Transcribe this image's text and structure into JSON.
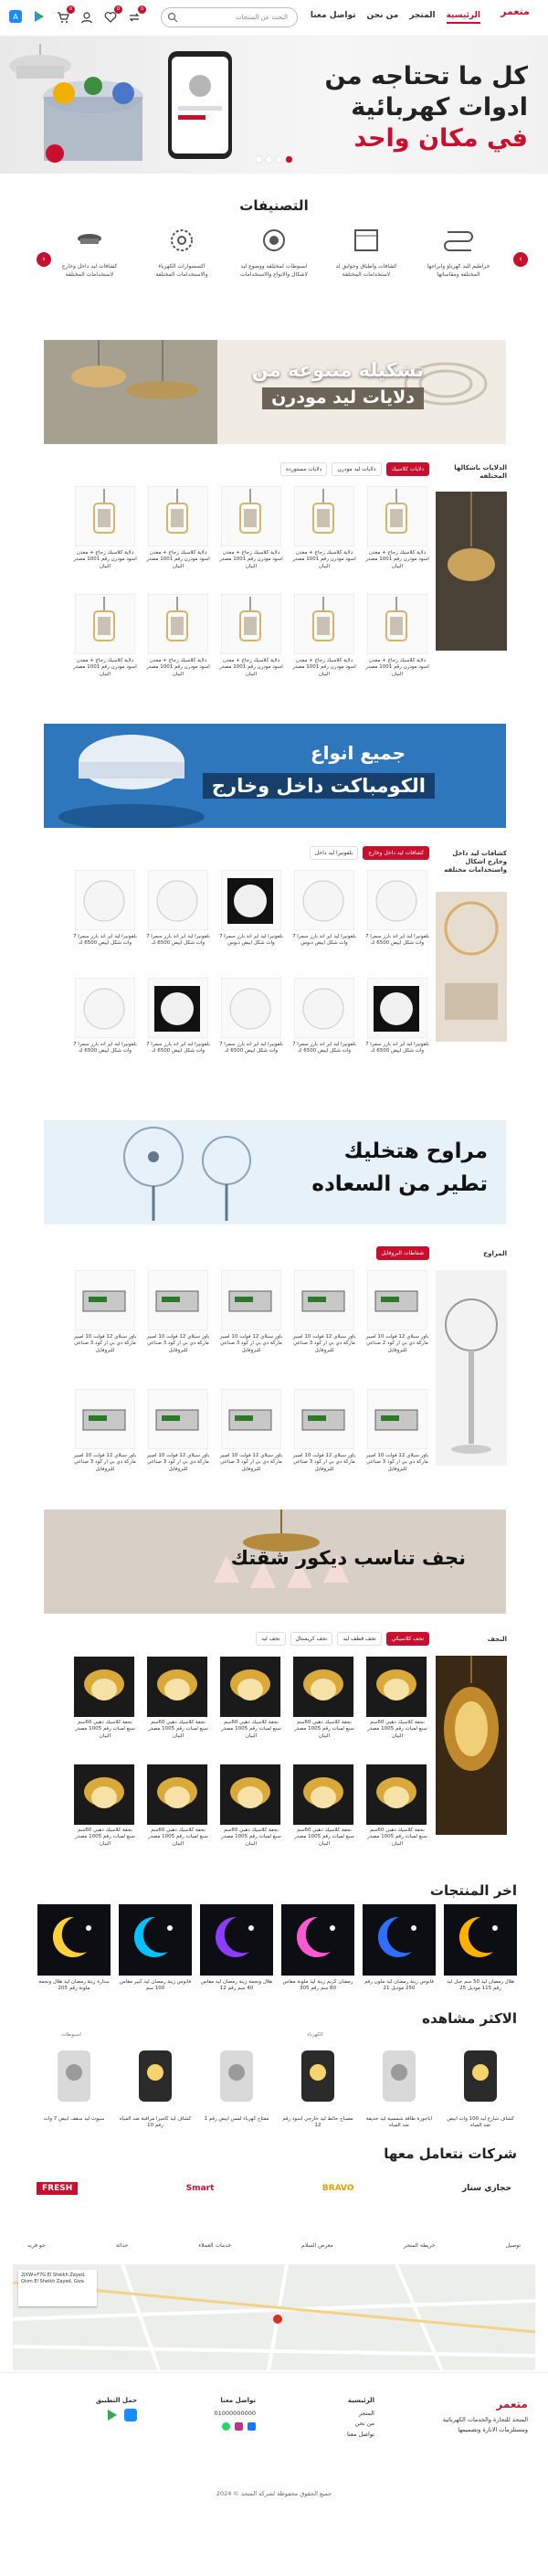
{
  "header": {
    "logo": "متعمر",
    "nav": [
      "الرئيسية",
      "المتجر",
      "من نحن",
      "تواصل معنا"
    ],
    "search_placeholder": "البحث عن المنتجات",
    "cart_count": "0",
    "wish_count": "0",
    "compare_count": "0"
  },
  "hero": {
    "line1": "كل ما تحتاجه من",
    "line2": "ادوات كهربائية",
    "line3": "في مكان واحد",
    "slides": 4,
    "active": 1
  },
  "categories": {
    "title": "التصنيفات",
    "items": [
      "خراطيم لليد كهرباؤ وابراجها المختلفه ومقاساتها",
      "كشافات واطباق وحوايق لد لاستخدامات المختلفة",
      "اسبوطات لمختلفه ووضوع ليد لاشكال والانواع والاستخدامات",
      "اكسسوارات الكهرباء والاستخدامات المختلفة",
      "كشافات ليد داخل وخارج لاستخدامات المختلفة",
      "كشافات ليد داخل وخارج لاستخدامات مختلفة"
    ]
  },
  "banner1": {
    "l1": "تشكيلة متنوعة من",
    "l2": "دلايات ليد مودرن"
  },
  "sec1": {
    "side": "الدلايات باشكالها المختلفه",
    "tabs": [
      "دلايات كلاسيك",
      "دلايات ليد مودرن",
      "دلايات مستورده"
    ],
    "products": [
      "دلاية كلاسيك زجاج + معدن اسود مودرن رقم 1001 مصدر البيان",
      "دلاية كلاسيك زجاج + معدن اسود مودرن رقم 1001 مصدر البيان",
      "دلاية كلاسيك زجاج + معدن اسود مودرن رقم 1001 مصدر البيان",
      "دلاية كلاسيك زجاج + معدن اسود مودرن رقم 1001 مصدر البيان",
      "دلاية كلاسيك زجاج + معدن اسود مودرن رقم 1001 مصدر البيان",
      "دلاية كلاسيك زجاج + معدن اسود مودرن رقم 1001 مصدر البيان",
      "دلاية كلاسيك زجاج + معدن اسود مودرن رقم 1001 مصدر البيان",
      "دلاية كلاسيك زجاج + معدن اسود مودرن رقم 1001 مصدر البيان",
      "دلاية كلاسيك زجاج + معدن اسود مودرن رقم 1001 مصدر البيان",
      "دلاية كلاسيك زجاج + معدن اسود مودرن رقم 1001 مصدر البيان"
    ]
  },
  "banner2": {
    "l1": "جميع انواع",
    "l2": "الكومباكت داخل وخارج"
  },
  "sec2": {
    "side": "كشافات ليد داخل وخارج اشكال واستخدامات مختلفه",
    "tabs": [
      "كشافات ليد داخل وخارج",
      "بلفونيرا ليد داخل"
    ],
    "products": [
      "بلفونيرا ليد اير اند بارز سمرا 7 وات شكل اييض 6500 ك",
      "بلفونيرا ليد اير اند بارز سمرا 7 وات شكل اييض دبوس",
      "بلفونيرا ليد اير اند بارز سمرا 7 وات شكل اييض دبوس",
      "بلفونيرا ليد اير اند بارز سمرا 7 وات شكل اييض 6500 ك",
      "بلفونيرا ليد اير اند بارز سمرا 7 وات شكل اييض 6500 ك",
      "بلفونيرا ليد اير اند بارز سمرا 7 وات شكل اييض 6500 ك",
      "بلفونيرا ليد اير اند بارز سمرا 7 وات شكل اييض 6500 ك",
      "بلفونيرا ليد اير اند بارز سمرا 7 وات شكل اييض 6500 ك",
      "بلفونيرا ليد اير اند بارز سمرا 7 وات شكل اييض 6500 ك",
      "بلفونيرا ليد اير اند بارز سمرا 7 وات شكل اييض 6500 ك"
    ]
  },
  "banner3": {
    "l1": "مراوح هتخليك",
    "l2": "تطير من السعاده"
  },
  "sec3": {
    "side": "المراوح",
    "tabs": [
      "شفاطات البروفايل"
    ],
    "products": [
      "باور سبلاي 12 فولت 10 امبير ماركة دي بي ار كود 2 صناعي للبروفايل",
      "باور سبلاي 12 فولت 10 امبير ماركة دي بي ار كود 3 صناعي للبروفايل",
      "باور سبلاي 12 فولت 10 امبير ماركة دي بي ار كود 3 صناعي للبروفايل",
      "باور سبلاي 12 فولت 10 امبير ماركة دي بي ار كود 3 صناعي للبروفايل",
      "باور سبلاي 12 فولت 10 امبير ماركة دي بي ار كود 3 صناعي للبروفايل",
      "باور سبلاي 12 فولت 10 امبير ماركة دي بي ار كود 3 صناعي للبروفايل",
      "باور سبلاي 12 فولت 10 امبير ماركة دي بي ار كود 3 صناعي للبروفايل",
      "باور سبلاي 12 فولت 10 امبير ماركة دي بي ار كود 3 صناعي للبروفايل",
      "باور سبلاي 12 فولت 10 امبير ماركة دي بي ار كود 3 صناعي للبروفايل",
      "باور سبلاي 12 فولت 10 امبير ماركة دي بي ار كود 3 صناعي للبروفايل"
    ]
  },
  "banner4": {
    "l1": "نجف تناسب ديكور شقتك"
  },
  "sec4": {
    "side": "النجف",
    "tabs": [
      "نجف كلاسيكي",
      "نجف قطف ليد",
      "نجف كريستال",
      "نجف ليد"
    ],
    "products": [
      "نجفة كلاسيك دهبي 60سم سبع لمبات رقم 1005 مصدر البيان",
      "نجفة كلاسيك دهبي 60سم سبع لمبات رقم 1005 مصدر البيان",
      "نجفة كلاسيك دهبي 60سم سبع لمبات رقم 1005 مصدر البيان",
      "نجفة كلاسيك دهبي 60سم سبع لمبات رقم 1005 مصدر البيان",
      "نجفة كلاسيك دهبي 60سم سبع لمبات رقم 1005 مصدر البيان",
      "نجفة كلاسيك دهبي 60سم سبع لمبات رقم 1005 مصدر البيان",
      "نجفة كلاسيك دهبي 60سم سبع لمبات رقم 1005 مصدر البيان",
      "نجفة كلاسيك دهبي 60سم سبع لمبات رقم 1005 مصدر البيان",
      "نجفة كلاسيك دهبي 60سم سبع لمبات رقم 1005 مصدر البيان",
      "نجفة كلاسيك دهبي 60سم سبع لمبات رقم 1005 مصدر البيان"
    ]
  },
  "latest": {
    "title": "اخر المنتجات",
    "items": [
      "هلال رمضان ليد 50 سم حبل ليد رقم 115 موديل 25",
      "فانوس زينة رمضان ليد ملون رقم 250 موديل 21",
      "رمضان كريم زينة ليد ملونة مقاس 80 سم رقم 305",
      "هلال ونجمة زينة رمضان ليد مقاس 40 سم رقم 12",
      "فانوس زينة رمضان ليد كبير مقاس 100 سم",
      "ستارة زينة رمضان ليد هلال ونجمة ملونة رقم 205"
    ]
  },
  "most": {
    "title": "الاكثر مشاهده",
    "items": [
      {
        "cat": "",
        "name": "كشاف شارع ليد 100 وات ابيض ضد المياه"
      },
      {
        "cat": "",
        "name": "اباجورة طاقة شمسية ليد حديقة ضد المياه"
      },
      {
        "cat": "الكهرباء",
        "name": "مصباح حائط ليد خارجي اسود رقم 12"
      },
      {
        "cat": "",
        "name": "مفتاح كهرباء لمس ابيض رقم 1"
      },
      {
        "cat": "",
        "name": "كشاف ليد كاميرا مراقبة ضد المياه رقم 10"
      },
      {
        "cat": "اسبوطات",
        "name": "سبوت ليد سقف ابيض 7 وات"
      }
    ]
  },
  "partners": {
    "title": "شركات نتعامل معها",
    "items": [
      "حجازي ستار",
      "BRAVO",
      "Smart",
      "FRESH"
    ]
  },
  "branches": [
    "توصيل",
    "خريطة المتجر",
    "معرض السلام",
    "خدمات العملاء",
    "حداثة",
    "جو فريد"
  ],
  "map": {
    "card": "2JXW+F7G El Sheikh Zayed, Qism El Sheikh Zayed, Giza"
  },
  "footer": {
    "about": "المتحد للتجارة والخدمات الكهربائية ومستلزمات الانارة وتصميمها",
    "col1_title": "الرئيسية",
    "col1": [
      "المتجر",
      "من نحن",
      "تواصل معنا"
    ],
    "col2_title": "تواصل معنا",
    "phone": "01000000000",
    "col3_title": "حمل التطبيق",
    "copyright": "جميع الحقوق محفوظة لشركة المتحد © 2024"
  },
  "colors": {
    "brand": "#c8102e",
    "banner_blue": "#2a6fb3"
  }
}
